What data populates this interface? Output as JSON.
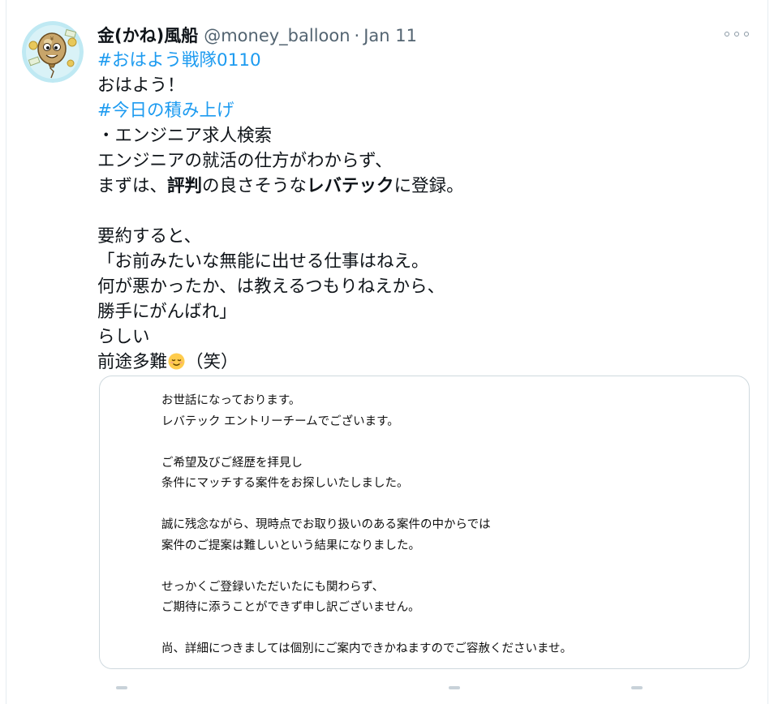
{
  "tweet": {
    "display_name": "金(かね)風船",
    "handle": "@money_balloon",
    "separator": "·",
    "date": "Jan 11",
    "avatar_icon": "balloon-character-avatar",
    "more_icon": "more-options-icon",
    "body": {
      "line1": "#おはよう戦隊0110",
      "line2": "おはよう！",
      "line3": "#今日の積み上げ",
      "line4": "・エンジニア求人検索",
      "line5": "エンジニアの就活の仕方がわからず、",
      "line6_a": "まずは、",
      "line6_b": "評判",
      "line6_c": "の良さそうな",
      "line6_d": "レバテック",
      "line6_e": "に登録。",
      "line7": "要約すると、",
      "line8": "「お前みたいな無能に出せる仕事はねえ。",
      "line9": "何が悪かったか、は教えるつもりねえから、",
      "line10": "勝手にがんばれ」",
      "line11": "らしい",
      "line12_a": "前途多難",
      "line12_emoji": "relieved-face-emoji",
      "line12_b": "（笑）"
    },
    "colors": {
      "hashtag": "#1d9bf0",
      "secondary_text": "#536471",
      "border": "#cfd9de"
    }
  },
  "email_image": {
    "line1": "お世話になっております。",
    "line2": "レバテック エントリーチームでございます。",
    "line3": "ご希望及びご経歴を拝見し",
    "line4": "条件にマッチする案件をお探しいたしました。",
    "line5": "誠に残念ながら、現時点でお取り扱いのある案件の中からでは",
    "line6": "案件のご提案は難しいという結果になりました。",
    "line7": "せっかくご登録いただいたにも関わらず、",
    "line8": "ご期待に添うことができず申し訳ございません。",
    "line9": "尚、詳細につきましては個別にご案内できかねますのでご容赦くださいませ。"
  }
}
